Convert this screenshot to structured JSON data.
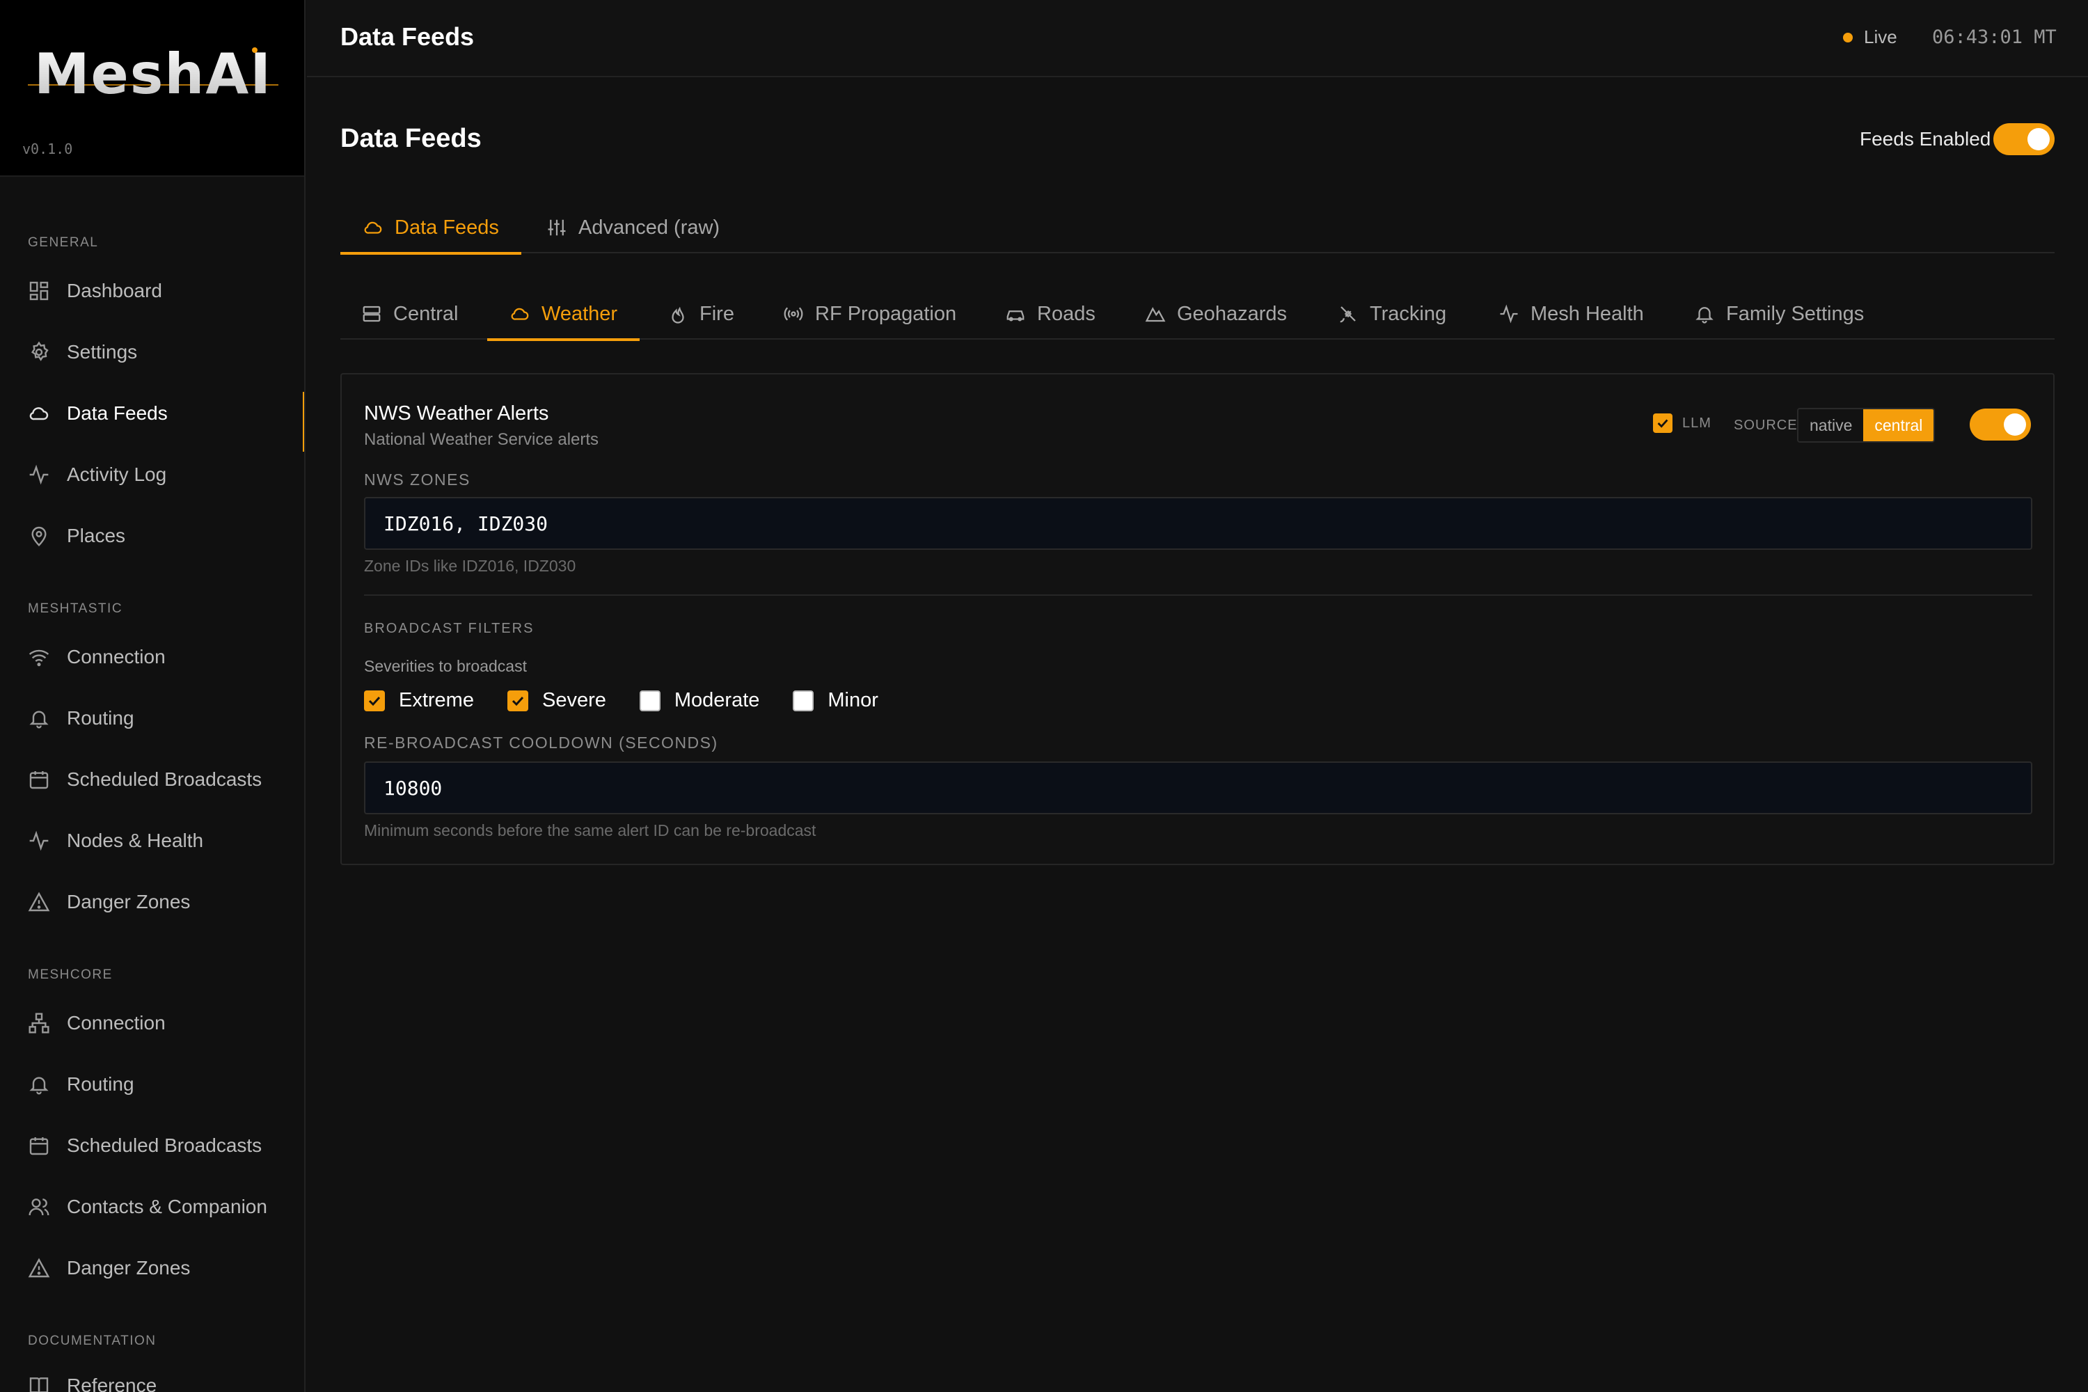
{
  "app": {
    "name": "MeshAI",
    "version": "v0.1.0"
  },
  "sidebar": {
    "sections": [
      {
        "label": "GENERAL",
        "items": [
          {
            "label": "Dashboard",
            "icon": "dashboard-icon"
          },
          {
            "label": "Settings",
            "icon": "gear-icon"
          },
          {
            "label": "Data Feeds",
            "icon": "cloud-icon",
            "active": true
          },
          {
            "label": "Activity Log",
            "icon": "activity-icon"
          },
          {
            "label": "Places",
            "icon": "map-pin-icon"
          }
        ]
      },
      {
        "label": "MESHTASTIC",
        "items": [
          {
            "label": "Connection",
            "icon": "wifi-icon"
          },
          {
            "label": "Routing",
            "icon": "bell-icon"
          },
          {
            "label": "Scheduled Broadcasts",
            "icon": "calendar-icon"
          },
          {
            "label": "Nodes & Health",
            "icon": "activity-icon"
          },
          {
            "label": "Danger Zones",
            "icon": "warning-icon"
          }
        ]
      },
      {
        "label": "MESHCORE",
        "items": [
          {
            "label": "Connection",
            "icon": "network-icon"
          },
          {
            "label": "Routing",
            "icon": "bell-icon"
          },
          {
            "label": "Scheduled Broadcasts",
            "icon": "calendar-icon"
          },
          {
            "label": "Contacts & Companion",
            "icon": "users-icon"
          },
          {
            "label": "Danger Zones",
            "icon": "warning-icon"
          }
        ]
      },
      {
        "label": "DOCUMENTATION",
        "items": [
          {
            "label": "Reference",
            "icon": "book-icon"
          }
        ]
      }
    ]
  },
  "header": {
    "title": "Data Feeds",
    "status": "Live",
    "clock": "06:43:01 MT"
  },
  "page": {
    "title": "Data Feeds",
    "feeds_enabled_label": "Feeds Enabled",
    "feeds_enabled": true
  },
  "primary_tabs": [
    {
      "label": "Data Feeds",
      "icon": "cloud-icon",
      "active": true
    },
    {
      "label": "Advanced (raw)",
      "icon": "sliders-icon",
      "active": false
    }
  ],
  "feed_tabs": [
    {
      "label": "Central",
      "icon": "server-icon"
    },
    {
      "label": "Weather",
      "icon": "cloud-icon",
      "active": true
    },
    {
      "label": "Fire",
      "icon": "flame-icon"
    },
    {
      "label": "RF Propagation",
      "icon": "radio-icon"
    },
    {
      "label": "Roads",
      "icon": "car-icon"
    },
    {
      "label": "Geohazards",
      "icon": "mountain-icon"
    },
    {
      "label": "Tracking",
      "icon": "satellite-icon"
    },
    {
      "label": "Mesh Health",
      "icon": "activity-icon"
    },
    {
      "label": "Family Settings",
      "icon": "bell-icon"
    }
  ],
  "card": {
    "title": "NWS Weather Alerts",
    "subtitle": "National Weather Service alerts",
    "llm_label": "LLM",
    "llm_checked": true,
    "source_label": "SOURCE",
    "source_options": [
      "native",
      "central"
    ],
    "source_selected": "central",
    "enabled": true,
    "zones_label": "NWS ZONES",
    "zones_value": "IDZ016, IDZ030",
    "zones_hint": "Zone IDs like IDZ016, IDZ030",
    "filters_label": "BROADCAST FILTERS",
    "severities_label": "Severities to broadcast",
    "severities": [
      {
        "label": "Extreme",
        "checked": true
      },
      {
        "label": "Severe",
        "checked": true
      },
      {
        "label": "Moderate",
        "checked": false
      },
      {
        "label": "Minor",
        "checked": false
      }
    ],
    "cooldown_label": "RE-BROADCAST COOLDOWN (SECONDS)",
    "cooldown_value": "10800",
    "cooldown_hint": "Minimum seconds before the same alert ID can be re-broadcast"
  },
  "colors": {
    "accent": "#f59e0b",
    "background": "#111111",
    "input_bg": "#0b0f17"
  }
}
